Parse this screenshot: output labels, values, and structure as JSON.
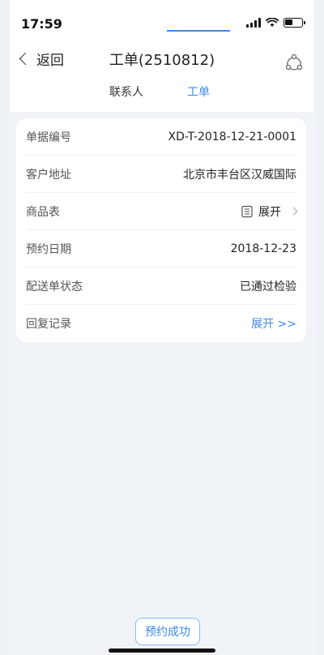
{
  "status_bar": {
    "time": "17:59"
  },
  "nav": {
    "back_label": "返回",
    "title": "工单(2510812)",
    "share_icon": "share-icon"
  },
  "tabs": [
    {
      "label": "联系人",
      "active": false
    },
    {
      "label": "工单",
      "active": true
    }
  ],
  "details": {
    "rows": [
      {
        "label": "单据编号",
        "value": "XD-T-2018-12-21-0001"
      },
      {
        "label": "客户地址",
        "value": "北京市丰台区汉威国际"
      },
      {
        "label": "商品表",
        "value": "展开"
      },
      {
        "label": "预约日期",
        "value": "2018-12-23"
      },
      {
        "label": "配送单状态",
        "value": "已通过检验"
      },
      {
        "label": "回复记录",
        "value": "展开 >>"
      }
    ]
  },
  "footer": {
    "button_label": "预约成功"
  },
  "colors": {
    "accent": "#3e8be6",
    "background": "#f0f3f7"
  }
}
